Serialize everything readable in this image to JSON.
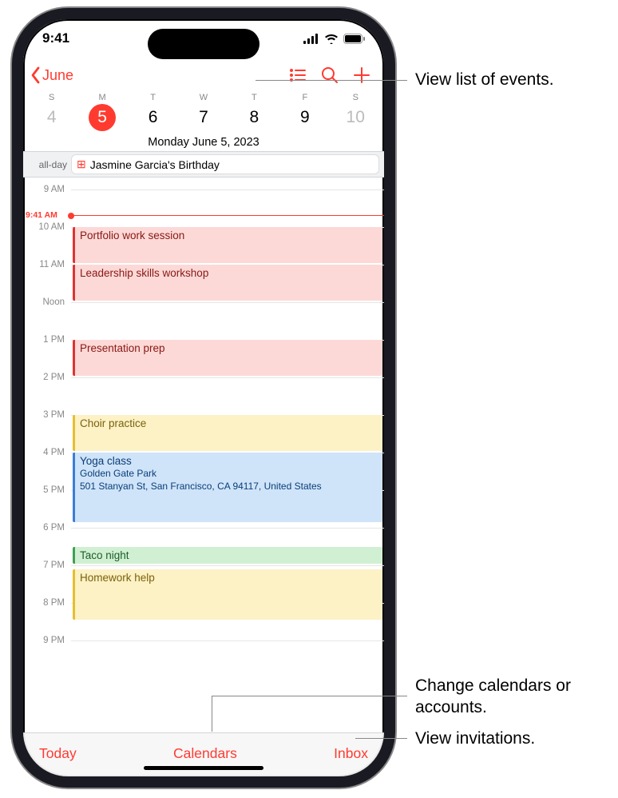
{
  "status": {
    "time": "9:41"
  },
  "nav": {
    "back": "June"
  },
  "week": {
    "days": [
      {
        "letter": "S",
        "num": "4",
        "muted": true
      },
      {
        "letter": "M",
        "num": "5",
        "sel": true
      },
      {
        "letter": "T",
        "num": "6"
      },
      {
        "letter": "W",
        "num": "7"
      },
      {
        "letter": "T",
        "num": "8"
      },
      {
        "letter": "F",
        "num": "9"
      },
      {
        "letter": "S",
        "num": "10",
        "muted": true
      }
    ],
    "fulldate": "Monday   June 5, 2023"
  },
  "allday": {
    "label": "all-day",
    "title": "Jasmine Garcia's Birthday"
  },
  "timeLabels": [
    "9 AM",
    "10 AM",
    "11 AM",
    "Noon",
    "1 PM",
    "2 PM",
    "3 PM",
    "4 PM",
    "5 PM",
    "6 PM",
    "7 PM",
    "8 PM",
    "9 PM"
  ],
  "nowLabel": "9:41 AM",
  "events": [
    {
      "title": "Portfolio work session",
      "color": "red",
      "startHour": 10,
      "endHour": 11
    },
    {
      "title": "Leadership skills workshop",
      "color": "red",
      "startHour": 11,
      "endHour": 12
    },
    {
      "title": "Presentation prep",
      "color": "red",
      "startHour": 13,
      "endHour": 14
    },
    {
      "title": "Choir practice",
      "color": "yellow",
      "startHour": 15,
      "endHour": 16
    },
    {
      "title": "Yoga class",
      "sub1": "Golden Gate Park",
      "sub2": "501 Stanyan St, San Francisco, CA 94117, United States",
      "color": "blue",
      "startHour": 16,
      "endHour": 17.9
    },
    {
      "title": "Taco night",
      "color": "green",
      "startHour": 18.5,
      "endHour": 19
    },
    {
      "title": "Homework help",
      "color": "yellow",
      "startHour": 19.1,
      "endHour": 20.5
    }
  ],
  "toolbar": {
    "today": "Today",
    "calendars": "Calendars",
    "inbox": "Inbox"
  },
  "callouts": {
    "listEvents": "View list of events.",
    "changeCal": "Change calendars or accounts.",
    "invitations": "View invitations."
  }
}
